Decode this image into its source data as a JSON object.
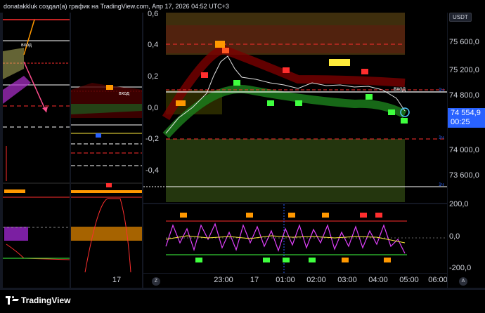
{
  "title": "donatakkluk создал(а) график на TradingView.com, Апр 17, 2026 04:52 UTC+3",
  "currency_badge": "USDT",
  "left_axis": [
    "0,6",
    "0,4",
    "0,2",
    "0,0",
    "-0,2",
    "-0,4"
  ],
  "right_axis": [
    "75 600,0",
    "75 200,0",
    "74 800,0",
    "74 000,0",
    "73 600,0"
  ],
  "osc_axis": [
    "200,0",
    "0,0",
    "-200,0"
  ],
  "current_price": "74 554,9",
  "countdown": "00:25",
  "time_axis": [
    "23:00",
    "17",
    "01:00",
    "02:00",
    "03:00",
    "04:00",
    "05:00",
    "06:00"
  ],
  "middle_pane_time": "17",
  "entry_label": "вход",
  "timeframe_tag": "1ч",
  "goto_left": "Z",
  "goto_right": "A",
  "brand": "TradingView",
  "colors": {
    "green": "#3fff3f",
    "red": "#ff2e2e",
    "orange": "#ff9800",
    "yellow": "#ffeb3b",
    "magenta": "#e040fb",
    "blue": "#2962ff"
  }
}
